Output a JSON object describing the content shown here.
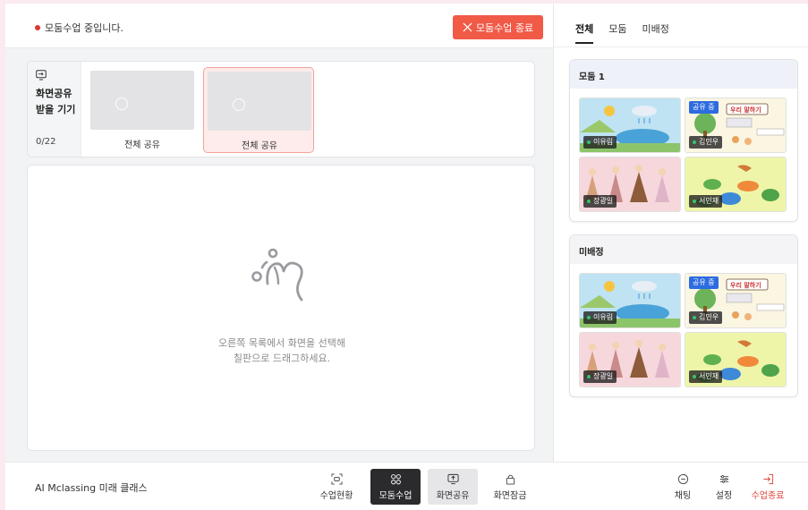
{
  "topbar": {
    "status_text": "모둠수업 중입니다.",
    "end_group_label": "모둠수업 종료"
  },
  "share": {
    "title_line1": "화면공유",
    "title_line2": "받을 기기",
    "count": "0/22",
    "items": [
      {
        "label": "전체 공유",
        "selected": false
      },
      {
        "label": "전체 공유",
        "selected": true
      }
    ]
  },
  "board": {
    "message_line1": "오른쪽 목록에서 화면을 선택해",
    "message_line2": "칠판으로 드래그하세요."
  },
  "right": {
    "tabs": [
      {
        "label": "전체",
        "active": true
      },
      {
        "label": "모둠",
        "active": false
      },
      {
        "label": "미배정",
        "active": false
      }
    ],
    "groups": [
      {
        "title": "모둠 1",
        "tiles": [
          {
            "name": "이유림",
            "art": "water-cycle",
            "sharing": false
          },
          {
            "name": "김민우",
            "art": "korean-lesson",
            "sharing": true,
            "sharing_label": "공유 중"
          },
          {
            "name": "장광일",
            "art": "hanbok-people",
            "sharing": false
          },
          {
            "name": "서민재",
            "art": "dinosaurs",
            "sharing": false
          }
        ]
      },
      {
        "title": "미배정",
        "tiles": [
          {
            "name": "이유림",
            "art": "water-cycle",
            "sharing": false
          },
          {
            "name": "김민우",
            "art": "korean-lesson",
            "sharing": true,
            "sharing_label": "공유 중"
          },
          {
            "name": "장광일",
            "art": "hanbok-people",
            "sharing": false
          },
          {
            "name": "서민재",
            "art": "dinosaurs",
            "sharing": false
          }
        ]
      }
    ]
  },
  "bottom": {
    "class_name": "AI Mclassing 미래 클래스",
    "tools": [
      {
        "label": "수업현황",
        "icon": "scan-icon"
      },
      {
        "label": "모둠수업",
        "icon": "group-icon",
        "state": "active-dark"
      },
      {
        "label": "화면공유",
        "icon": "screen-share-icon",
        "state": "active-light"
      },
      {
        "label": "화면잠금",
        "icon": "lock-icon"
      },
      {
        "label": "채팅",
        "icon": "chat-icon"
      },
      {
        "label": "설정",
        "icon": "settings-icon"
      },
      {
        "label": "수업종료",
        "icon": "exit-icon",
        "state": "danger"
      }
    ]
  },
  "colors": {
    "accent_red": "#f05a47",
    "sharing_blue": "#2d6be0",
    "online_green": "#35c46b"
  }
}
